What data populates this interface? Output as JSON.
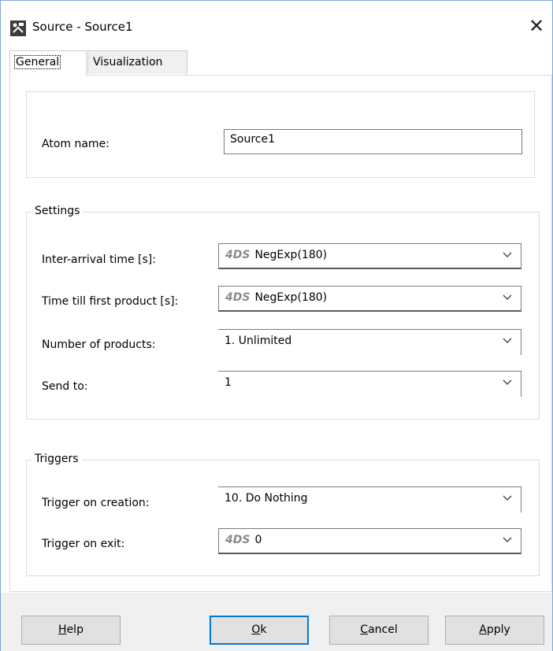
{
  "window": {
    "title": "Source - Source1",
    "close_glyph": "✕"
  },
  "tabs": [
    {
      "label": "General"
    },
    {
      "label": "Visualization"
    }
  ],
  "atom": {
    "label": "Atom name:",
    "value": "Source1"
  },
  "settings": {
    "legend": "Settings",
    "inter_arrival": {
      "label": "Inter-arrival time [s]:",
      "tag": "4DS",
      "value": "NegExp(180)"
    },
    "first_product": {
      "label": "Time till first product [s]:",
      "tag": "4DS",
      "value": "NegExp(180)"
    },
    "num_products": {
      "label": "Number of products:",
      "value": "1. Unlimited"
    },
    "send_to": {
      "label": "Send to:",
      "value": "1"
    }
  },
  "triggers": {
    "legend": "Triggers",
    "on_creation": {
      "label": "Trigger on creation:",
      "value": "10. Do Nothing"
    },
    "on_exit": {
      "label": "Trigger on exit:",
      "tag": "4DS",
      "value": "0"
    }
  },
  "buttons": {
    "help": {
      "mnemonic": "H",
      "rest": "elp"
    },
    "ok": {
      "mnemonic": "O",
      "rest": "k"
    },
    "cancel": {
      "mnemonic": "C",
      "rest": "ancel"
    },
    "apply": {
      "mnemonic": "A",
      "rest": "pply"
    }
  },
  "icons": {
    "app": "enterprise-dynamics-icon",
    "chevron": "chevron-down-icon"
  }
}
